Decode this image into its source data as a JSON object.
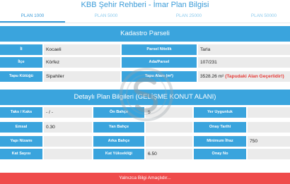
{
  "app": {
    "title": "KBB Şehir Rehberi - İmar Plan Bilgisi"
  },
  "tabs": [
    {
      "label": "PLAN 1000",
      "active": true
    },
    {
      "label": "PLAN 5000",
      "active": false
    },
    {
      "label": "PLAN 25000",
      "active": false
    },
    {
      "label": "PLAN 50000",
      "active": false
    }
  ],
  "kadastro": {
    "title": "Kadastro Parseli",
    "il_label": "İl",
    "il_value": "Kocaeli",
    "parsel_nitelik_label": "Parsel Nitelik",
    "parsel_nitelik_value": "Tarla",
    "ilce_label": "İlçe",
    "ilce_value": "Körfez",
    "ada_parsel_label": "Ada/Parsel",
    "ada_parsel_value": "107/231",
    "tapu_kutugu_label": "Tapu Kütüğü",
    "tapu_kutugu_value": "Sipahiler",
    "alan_label": "Tapu Alanı (m²)",
    "alan_value": "3528.26 m²",
    "alan_note": "(Tapudaki Alan Geçerlidir!)"
  },
  "plan": {
    "title": "Detaylı Plan Bilgileri (GELİŞME KONUT ALANI)",
    "taks_kaks_label": "Taks / Kaks",
    "taks_kaks_value": "- / -",
    "on_bahce_label": "Ön Bahçe",
    "on_bahce_value": "5",
    "yer_uygunluk_label": "Yer Uygunluk",
    "yer_uygunluk_value": "",
    "emsal_label": "Emsal",
    "emsal_value": "0.30",
    "yan_bahce_label": "Yan Bahçe",
    "yan_bahce_value": "",
    "onay_tarihi_label": "Onay Tarihi",
    "onay_tarihi_value": "",
    "yapi_nizami_label": "Yapı Nizamı",
    "yapi_nizami_value": "",
    "arka_bahce_label": "Arka Bahçe",
    "arka_bahce_value": "",
    "minimum_ifraz_label": "Minimum İfraz",
    "minimum_ifraz_value": "750",
    "kat_sayisi_label": "Kat Sayısı",
    "kat_sayisi_value": "",
    "kat_yuksekligi_label": "Kat Yüksekliği",
    "kat_yuksekligi_value": "6.50",
    "onay_no_label": "Onay No",
    "onay_no_value": ""
  },
  "footer": {
    "notice": "Yalnızca Bilgi Amaçlıdır..."
  },
  "colors": {
    "accent": "#3aa4dd",
    "cell_bg": "#ebebeb",
    "warning": "#ef4b4b"
  },
  "watermark": {
    "icon": "watermark-logo-icon"
  }
}
